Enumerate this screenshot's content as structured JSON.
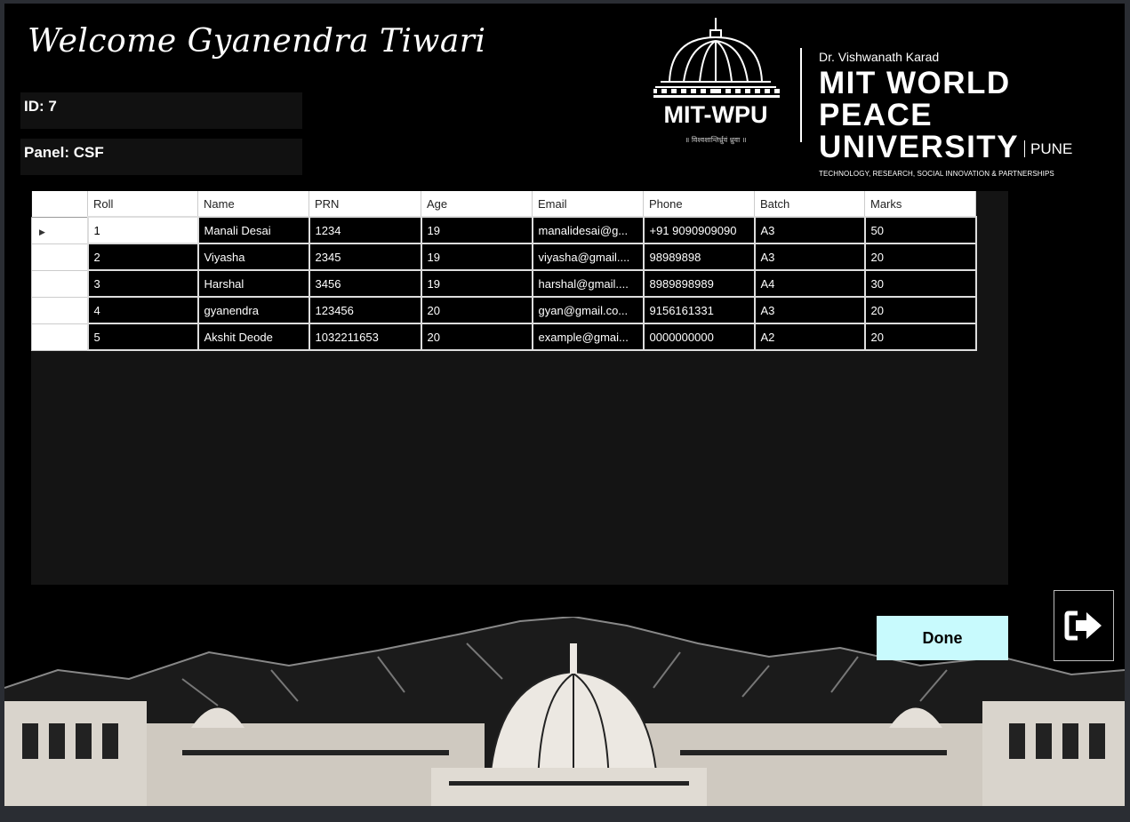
{
  "header": {
    "welcome": "Welcome Gyanendra Tiwari",
    "id_label": "ID: 7",
    "panel_label": "Panel: CSF"
  },
  "logo": {
    "emblem_text": "MIT-WPU",
    "emblem_motto": "॥ विश्वशान्तिर्ध्रुवं ध्रुवा ॥",
    "subtitle": "Dr. Vishwanath Karad",
    "line1": "MIT WORLD PEACE",
    "line2": "UNIVERSITY",
    "city": "PUNE",
    "tagline": "TECHNOLOGY, RESEARCH, SOCIAL INNOVATION & PARTNERSHIPS"
  },
  "table": {
    "columns": [
      "Roll",
      "Name",
      "PRN",
      "Age",
      "Email",
      "Phone",
      "Batch",
      "Marks"
    ],
    "current_row_marker": "▶",
    "rows": [
      [
        "1",
        "Manali Desai",
        "1234",
        "19",
        "manalidesai@g...",
        "+91 9090909090",
        "A3",
        "50"
      ],
      [
        "2",
        "Viyasha",
        "2345",
        "19",
        "viyasha@gmail....",
        "98989898",
        "A3",
        "20"
      ],
      [
        "3",
        "Harshal",
        "3456",
        "19",
        "harshal@gmail....",
        "8989898989",
        "A4",
        "30"
      ],
      [
        "4",
        "gyanendra",
        "123456",
        "20",
        "gyan@gmail.co...",
        "9156161331",
        "A3",
        "20"
      ],
      [
        "5",
        "Akshit Deode",
        "1032211653",
        "20",
        "example@gmai...",
        "0000000000",
        "A2",
        "20"
      ]
    ]
  },
  "actions": {
    "done_label": "Done",
    "logout_icon": "logout-arrow-icon"
  },
  "colors": {
    "background": "#000000",
    "done_button": "#c8fafd",
    "grid_background": "#141414"
  }
}
